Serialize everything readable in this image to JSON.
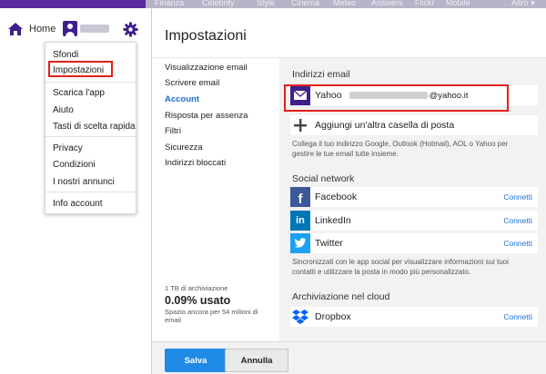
{
  "top_nav": {
    "home_label": "Home",
    "dimmed_tabs": [
      "Finanza",
      "Celebrity",
      "Style",
      "Cinema",
      "Meteo",
      "Answers",
      "Flickr",
      "Mobile",
      "Altro ▾"
    ]
  },
  "dropdown": {
    "items": [
      "Sfondi",
      "Impostazioni",
      "Scarica l'app",
      "Aiuto",
      "Tasti di scelta rapida",
      "Privacy",
      "Condizioni",
      "I nostri annunci",
      "Info account"
    ]
  },
  "settings": {
    "title": "Impostazioni",
    "nav": [
      "Visualizzazione email",
      "Scrivere email",
      "Account",
      "Risposta per assenza",
      "Filtri",
      "Sicurezza",
      "Indirizzi bloccati"
    ],
    "active_nav": "Account",
    "storage": {
      "capacity": "1 TB di archiviazione",
      "used": "0.09% usato",
      "remaining": "Spazio ancora per 54 milioni di email"
    },
    "email_section": {
      "title": "Indirizzi email",
      "account_label": "Yahoo",
      "account_domain": "@yahoo.it",
      "add_label": "Aggiungi un'altra casella di posta",
      "note": "Collega il tuo indirizzo Google, Outlook (Hotmail), AOL o Yahoo per gestire le tue email tutte insieme."
    },
    "social_section": {
      "title": "Social network",
      "items": [
        {
          "name": "Facebook",
          "action": "Connetti"
        },
        {
          "name": "LinkedIn",
          "action": "Connetti"
        },
        {
          "name": "Twitter",
          "action": "Connetti"
        }
      ],
      "note": "Sincronizzati con le app social per visualizzare informazioni sui tuoi contatti e utilizzare la posta in modo più personalizzato."
    },
    "cloud_section": {
      "title": "Archiviazione nel cloud",
      "items": [
        {
          "name": "Dropbox",
          "action": "Connetti"
        }
      ]
    },
    "buttons": {
      "save": "Salva",
      "cancel": "Annulla"
    }
  },
  "colors": {
    "yahoo_purple": "#3f1f8c",
    "link_blue": "#1a6fd1",
    "save_blue": "#1f8ae6",
    "highlight_red": "#e0201b",
    "facebook": "#3b5998",
    "linkedin": "#0077b5",
    "twitter": "#1da1f2",
    "dropbox": "#0061fe"
  },
  "icons": [
    "home-icon",
    "avatar-icon",
    "gear-icon",
    "envelope-icon",
    "plus-icon",
    "facebook-icon",
    "linkedin-icon",
    "twitter-icon",
    "dropbox-icon"
  ]
}
